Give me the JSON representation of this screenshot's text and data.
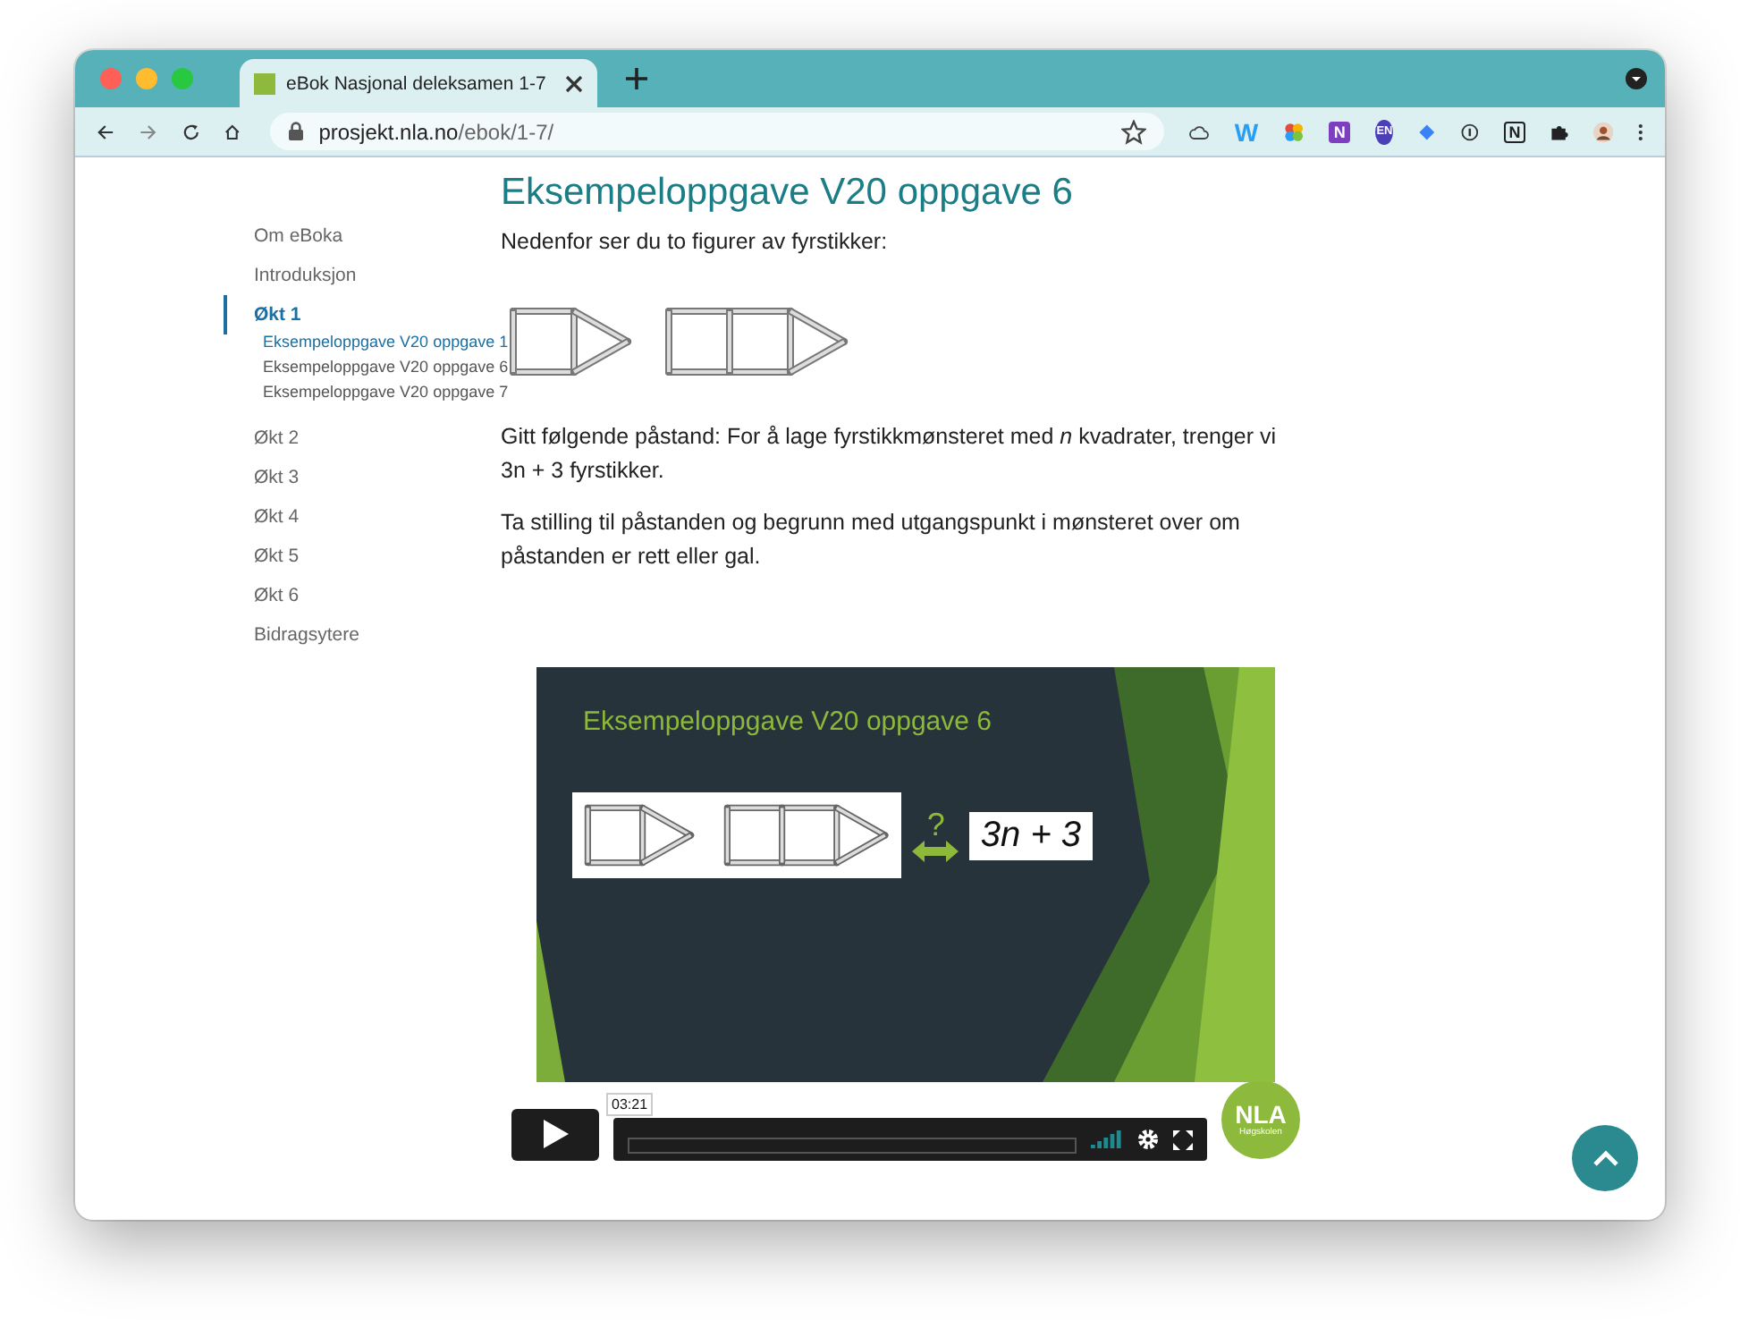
{
  "browser": {
    "tab_title": "eBok Nasjonal deleksamen 1-7",
    "url_host": "prosjekt.nla.no",
    "url_path": "/ebok/1-7/",
    "extensions": [
      {
        "kind": "cloud"
      },
      {
        "kind": "letter",
        "label": "W"
      },
      {
        "kind": "pinwheel"
      },
      {
        "kind": "square-letter",
        "label": "N"
      },
      {
        "kind": "circle-letter",
        "label": "EN"
      },
      {
        "kind": "diamond"
      },
      {
        "kind": "info"
      },
      {
        "kind": "notion",
        "label": "N"
      },
      {
        "kind": "puzzle"
      },
      {
        "kind": "avatar"
      }
    ]
  },
  "sidebar": {
    "items": [
      {
        "label": "Om eBoka",
        "selected": false
      },
      {
        "label": "Introduksjon",
        "selected": false
      },
      {
        "label": "Økt 1",
        "selected": true,
        "children": [
          {
            "label": "Eksempeloppgave V20 oppgave 1",
            "selected": true
          },
          {
            "label": "Eksempeloppgave V20 oppgave 6",
            "selected": false
          },
          {
            "label": "Eksempeloppgave V20 oppgave 7",
            "selected": false
          }
        ]
      },
      {
        "label": "Økt 2",
        "selected": false
      },
      {
        "label": "Økt 3",
        "selected": false
      },
      {
        "label": "Økt 4",
        "selected": false
      },
      {
        "label": "Økt 5",
        "selected": false
      },
      {
        "label": "Økt 6",
        "selected": false
      },
      {
        "label": "Bidragsytere",
        "selected": false
      }
    ]
  },
  "article": {
    "title": "Eksempeloppgave V20 oppgave 6",
    "intro": "Nedenfor ser du to figurer av fyrstikker:",
    "paragraphs": [
      "Gitt følgende påstand: For å lage fyrstikkmønsteret med *n* kvadrater, trenger vi 3n + 3 fyrstikker.",
      "Ta stilling til påstanden og begrunn med utgangspunkt i mønsteret over om påstanden er rett eller gal."
    ]
  },
  "video": {
    "slide_title": "Eksempeloppgave V20 oppgave 6",
    "question_mark": "?",
    "formula": "3n + 3",
    "time": "03:21",
    "playing": false
  },
  "logo": {
    "name": "NLA",
    "subtitle": "Høgskolen"
  }
}
